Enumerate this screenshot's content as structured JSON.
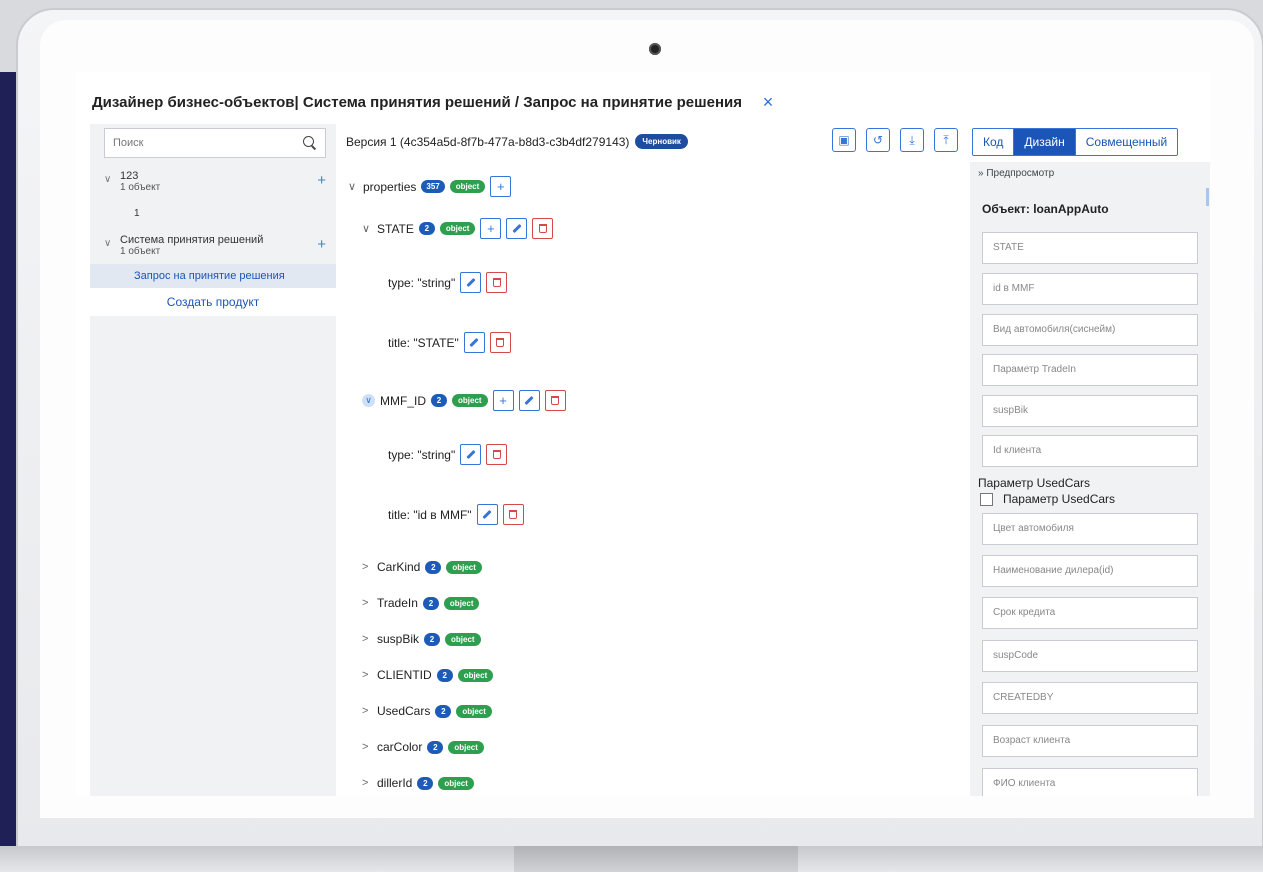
{
  "app": {
    "title": "Дизайнер бизнес-объектов| Система принятия решений / Запрос на принятие решения",
    "close_label": "×"
  },
  "sidebar": {
    "search_placeholder": "Поиск",
    "nodes": [
      {
        "name": "123",
        "sub": "1 объект",
        "child": "1"
      },
      {
        "name": "Система принятия решений",
        "sub": "1 объект",
        "child": "Запрос на принятие решения"
      }
    ],
    "create_label": "Создать продукт"
  },
  "header": {
    "version": "Версия 1 (4c354a5d-8f7b-477a-b8d3-c3b4df279143)",
    "draft_badge": "Черновик",
    "tabs": [
      "Код",
      "Дизайн",
      "Совмещенный"
    ],
    "active_tab": "Дизайн"
  },
  "editor": {
    "root": {
      "name": "properties",
      "count": "357",
      "type": "object"
    },
    "state": {
      "name": "STATE",
      "count": "2",
      "type": "object",
      "type_line": "type: \"string\"",
      "title_line": "title: \"STATE\""
    },
    "mmf": {
      "name": "MMF_ID",
      "count": "2",
      "type": "object",
      "type_line": "type: \"string\"",
      "title_line": "title: \"id в MMF\""
    },
    "collapsed": [
      {
        "name": "CarKind",
        "count": "2",
        "type": "object"
      },
      {
        "name": "TradeIn",
        "count": "2",
        "type": "object"
      },
      {
        "name": "suspBik",
        "count": "2",
        "type": "object"
      },
      {
        "name": "CLIENTID",
        "count": "2",
        "type": "object"
      },
      {
        "name": "UsedCars",
        "count": "2",
        "type": "object"
      },
      {
        "name": "carColor",
        "count": "2",
        "type": "object"
      },
      {
        "name": "dillerId",
        "count": "2",
        "type": "object"
      }
    ]
  },
  "preview": {
    "header": "Предпросмотр",
    "object_title": "Объект: loanAppAuto",
    "fields_top": [
      "STATE",
      "id в MMF",
      "Вид автомобиля(сиснейм)",
      "Параметр TradeIn",
      "suspBik",
      "Id клиента"
    ],
    "checkbox_group_label": "Параметр UsedCars",
    "checkbox_label": "Параметр UsedCars",
    "fields_bottom": [
      "Цвет автомобиля",
      "Наименование дилера(id)",
      "Срок кредита",
      "suspCode",
      "CREATEDBY",
      "Возраст клиента",
      "ФИО клиента"
    ]
  }
}
